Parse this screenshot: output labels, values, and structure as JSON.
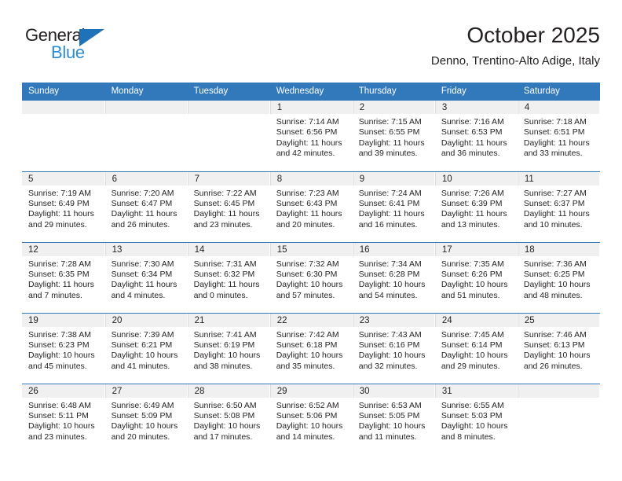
{
  "brand": {
    "name_part1": "General",
    "name_part2": "Blue",
    "triangle_color": "#1f72b8",
    "blue_text_color": "#2b8bd4",
    "dark_text_color": "#231f20"
  },
  "header": {
    "title": "October 2025",
    "subtitle": "Denno, Trentino-Alto Adige, Italy"
  },
  "colors": {
    "header_row_bg": "#3279bc",
    "header_row_text": "#ffffff",
    "daynum_band_bg": "#f0f0f0",
    "cell_bg": "#ffffff",
    "row_divider": "#3279bc"
  },
  "weekday_headers": [
    "Sunday",
    "Monday",
    "Tuesday",
    "Wednesday",
    "Thursday",
    "Friday",
    "Saturday"
  ],
  "weeks": [
    [
      {
        "day": "",
        "empty": true,
        "lines": []
      },
      {
        "day": "",
        "empty": true,
        "lines": []
      },
      {
        "day": "",
        "empty": true,
        "lines": []
      },
      {
        "day": "1",
        "empty": false,
        "lines": [
          "Sunrise: 7:14 AM",
          "Sunset: 6:56 PM",
          "Daylight: 11 hours",
          "and 42 minutes."
        ]
      },
      {
        "day": "2",
        "empty": false,
        "lines": [
          "Sunrise: 7:15 AM",
          "Sunset: 6:55 PM",
          "Daylight: 11 hours",
          "and 39 minutes."
        ]
      },
      {
        "day": "3",
        "empty": false,
        "lines": [
          "Sunrise: 7:16 AM",
          "Sunset: 6:53 PM",
          "Daylight: 11 hours",
          "and 36 minutes."
        ]
      },
      {
        "day": "4",
        "empty": false,
        "lines": [
          "Sunrise: 7:18 AM",
          "Sunset: 6:51 PM",
          "Daylight: 11 hours",
          "and 33 minutes."
        ]
      }
    ],
    [
      {
        "day": "5",
        "empty": false,
        "lines": [
          "Sunrise: 7:19 AM",
          "Sunset: 6:49 PM",
          "Daylight: 11 hours",
          "and 29 minutes."
        ]
      },
      {
        "day": "6",
        "empty": false,
        "lines": [
          "Sunrise: 7:20 AM",
          "Sunset: 6:47 PM",
          "Daylight: 11 hours",
          "and 26 minutes."
        ]
      },
      {
        "day": "7",
        "empty": false,
        "lines": [
          "Sunrise: 7:22 AM",
          "Sunset: 6:45 PM",
          "Daylight: 11 hours",
          "and 23 minutes."
        ]
      },
      {
        "day": "8",
        "empty": false,
        "lines": [
          "Sunrise: 7:23 AM",
          "Sunset: 6:43 PM",
          "Daylight: 11 hours",
          "and 20 minutes."
        ]
      },
      {
        "day": "9",
        "empty": false,
        "lines": [
          "Sunrise: 7:24 AM",
          "Sunset: 6:41 PM",
          "Daylight: 11 hours",
          "and 16 minutes."
        ]
      },
      {
        "day": "10",
        "empty": false,
        "lines": [
          "Sunrise: 7:26 AM",
          "Sunset: 6:39 PM",
          "Daylight: 11 hours",
          "and 13 minutes."
        ]
      },
      {
        "day": "11",
        "empty": false,
        "lines": [
          "Sunrise: 7:27 AM",
          "Sunset: 6:37 PM",
          "Daylight: 11 hours",
          "and 10 minutes."
        ]
      }
    ],
    [
      {
        "day": "12",
        "empty": false,
        "lines": [
          "Sunrise: 7:28 AM",
          "Sunset: 6:35 PM",
          "Daylight: 11 hours",
          "and 7 minutes."
        ]
      },
      {
        "day": "13",
        "empty": false,
        "lines": [
          "Sunrise: 7:30 AM",
          "Sunset: 6:34 PM",
          "Daylight: 11 hours",
          "and 4 minutes."
        ]
      },
      {
        "day": "14",
        "empty": false,
        "lines": [
          "Sunrise: 7:31 AM",
          "Sunset: 6:32 PM",
          "Daylight: 11 hours",
          "and 0 minutes."
        ]
      },
      {
        "day": "15",
        "empty": false,
        "lines": [
          "Sunrise: 7:32 AM",
          "Sunset: 6:30 PM",
          "Daylight: 10 hours",
          "and 57 minutes."
        ]
      },
      {
        "day": "16",
        "empty": false,
        "lines": [
          "Sunrise: 7:34 AM",
          "Sunset: 6:28 PM",
          "Daylight: 10 hours",
          "and 54 minutes."
        ]
      },
      {
        "day": "17",
        "empty": false,
        "lines": [
          "Sunrise: 7:35 AM",
          "Sunset: 6:26 PM",
          "Daylight: 10 hours",
          "and 51 minutes."
        ]
      },
      {
        "day": "18",
        "empty": false,
        "lines": [
          "Sunrise: 7:36 AM",
          "Sunset: 6:25 PM",
          "Daylight: 10 hours",
          "and 48 minutes."
        ]
      }
    ],
    [
      {
        "day": "19",
        "empty": false,
        "lines": [
          "Sunrise: 7:38 AM",
          "Sunset: 6:23 PM",
          "Daylight: 10 hours",
          "and 45 minutes."
        ]
      },
      {
        "day": "20",
        "empty": false,
        "lines": [
          "Sunrise: 7:39 AM",
          "Sunset: 6:21 PM",
          "Daylight: 10 hours",
          "and 41 minutes."
        ]
      },
      {
        "day": "21",
        "empty": false,
        "lines": [
          "Sunrise: 7:41 AM",
          "Sunset: 6:19 PM",
          "Daylight: 10 hours",
          "and 38 minutes."
        ]
      },
      {
        "day": "22",
        "empty": false,
        "lines": [
          "Sunrise: 7:42 AM",
          "Sunset: 6:18 PM",
          "Daylight: 10 hours",
          "and 35 minutes."
        ]
      },
      {
        "day": "23",
        "empty": false,
        "lines": [
          "Sunrise: 7:43 AM",
          "Sunset: 6:16 PM",
          "Daylight: 10 hours",
          "and 32 minutes."
        ]
      },
      {
        "day": "24",
        "empty": false,
        "lines": [
          "Sunrise: 7:45 AM",
          "Sunset: 6:14 PM",
          "Daylight: 10 hours",
          "and 29 minutes."
        ]
      },
      {
        "day": "25",
        "empty": false,
        "lines": [
          "Sunrise: 7:46 AM",
          "Sunset: 6:13 PM",
          "Daylight: 10 hours",
          "and 26 minutes."
        ]
      }
    ],
    [
      {
        "day": "26",
        "empty": false,
        "lines": [
          "Sunrise: 6:48 AM",
          "Sunset: 5:11 PM",
          "Daylight: 10 hours",
          "and 23 minutes."
        ]
      },
      {
        "day": "27",
        "empty": false,
        "lines": [
          "Sunrise: 6:49 AM",
          "Sunset: 5:09 PM",
          "Daylight: 10 hours",
          "and 20 minutes."
        ]
      },
      {
        "day": "28",
        "empty": false,
        "lines": [
          "Sunrise: 6:50 AM",
          "Sunset: 5:08 PM",
          "Daylight: 10 hours",
          "and 17 minutes."
        ]
      },
      {
        "day": "29",
        "empty": false,
        "lines": [
          "Sunrise: 6:52 AM",
          "Sunset: 5:06 PM",
          "Daylight: 10 hours",
          "and 14 minutes."
        ]
      },
      {
        "day": "30",
        "empty": false,
        "lines": [
          "Sunrise: 6:53 AM",
          "Sunset: 5:05 PM",
          "Daylight: 10 hours",
          "and 11 minutes."
        ]
      },
      {
        "day": "31",
        "empty": false,
        "lines": [
          "Sunrise: 6:55 AM",
          "Sunset: 5:03 PM",
          "Daylight: 10 hours",
          "and 8 minutes."
        ]
      },
      {
        "day": "",
        "empty": true,
        "lines": []
      }
    ]
  ]
}
